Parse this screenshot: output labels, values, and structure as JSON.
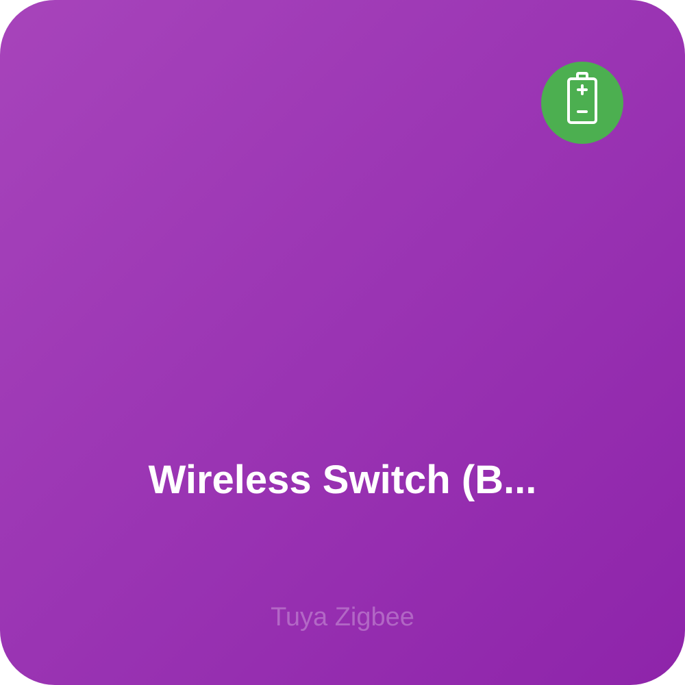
{
  "device": {
    "name": "Wireless Switch (B...",
    "vendor": "Tuya Zigbee",
    "badge_icon": "battery-icon",
    "badge_color": "#4caf50"
  },
  "colors": {
    "tile_gradient_start": "#a744bb",
    "tile_gradient_end": "#8e24aa",
    "text": "#ffffff"
  }
}
